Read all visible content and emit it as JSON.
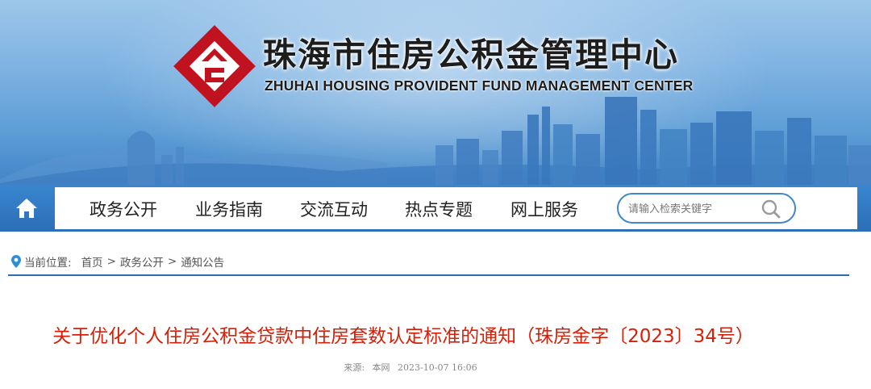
{
  "header": {
    "title": "珠海市住房公积金管理中心",
    "subtitle": "ZHUHAI HOUSING PROVIDENT FUND MANAGEMENT CENTER",
    "logo_icon": "zhuhai-hpf-logo-icon",
    "colors": {
      "logo_red": "#c1121f",
      "banner_blue": "#4a8ed0"
    }
  },
  "nav": {
    "home_icon": "home-icon",
    "items": [
      {
        "label": "政务公开"
      },
      {
        "label": "业务指南"
      },
      {
        "label": "交流互动"
      },
      {
        "label": "热点专题"
      },
      {
        "label": "网上服务"
      }
    ],
    "search": {
      "placeholder": "请输入检索关键字",
      "icon": "search-icon"
    },
    "colors": {
      "bar": "#2f79c1",
      "search_border": "#3f86cb"
    }
  },
  "breadcrumb": {
    "label": "当前位置:",
    "icon": "location-pin-icon",
    "items": [
      "首页",
      "政务公开",
      "通知公告"
    ],
    "separator": ">"
  },
  "article": {
    "title": "关于优化个人住房公积金贷款中住房套数认定标准的通知（珠房金字〔2023〕34号）",
    "source_label": "来源:",
    "source": "本网",
    "date": "2023-10-07 16:06",
    "colors": {
      "title": "#d81e06"
    }
  }
}
